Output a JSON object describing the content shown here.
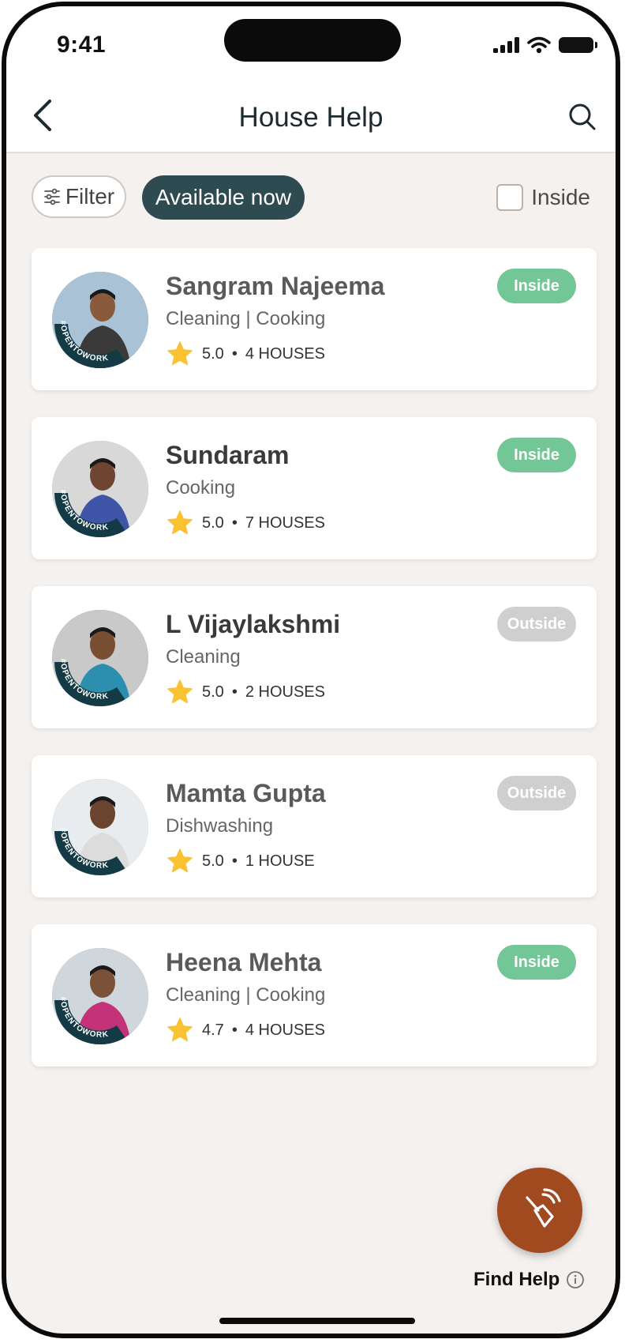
{
  "status_bar": {
    "time": "9:41"
  },
  "header": {
    "title": "House Help"
  },
  "filters": {
    "filter_label": "Filter",
    "available_label": "Available now",
    "inside_label": "Inside",
    "inside_checked": false
  },
  "helpers": [
    {
      "name": "Sangram Najeema",
      "skills": "Cleaning | Cooking",
      "rating": "5.0",
      "houses": "4 HOUSES",
      "status": "Inside"
    },
    {
      "name": "Sundaram",
      "skills": "Cooking",
      "rating": "5.0",
      "houses": "7 HOUSES",
      "status": "Inside"
    },
    {
      "name": "L Vijaylakshmi",
      "skills": "Cleaning",
      "rating": "5.0",
      "houses": "2 HOUSES",
      "status": "Outside"
    },
    {
      "name": "Mamta Gupta",
      "skills": "Dishwashing",
      "rating": "5.0",
      "houses": "1 HOUSE",
      "status": "Outside"
    },
    {
      "name": "Heena Mehta",
      "skills": "Cleaning | Cooking",
      "rating": "4.7",
      "houses": "4 HOUSES",
      "status": "Inside"
    }
  ],
  "avatar_ring_text": "#OPENTOWORK",
  "rating_separator": "•",
  "fab": {
    "label": "Find Help"
  },
  "colors": {
    "inside": "#73c695",
    "outside": "#cfcfcf",
    "chip_active": "#2f4b52",
    "fab": "#a14a1f",
    "star": "#f8c233"
  }
}
